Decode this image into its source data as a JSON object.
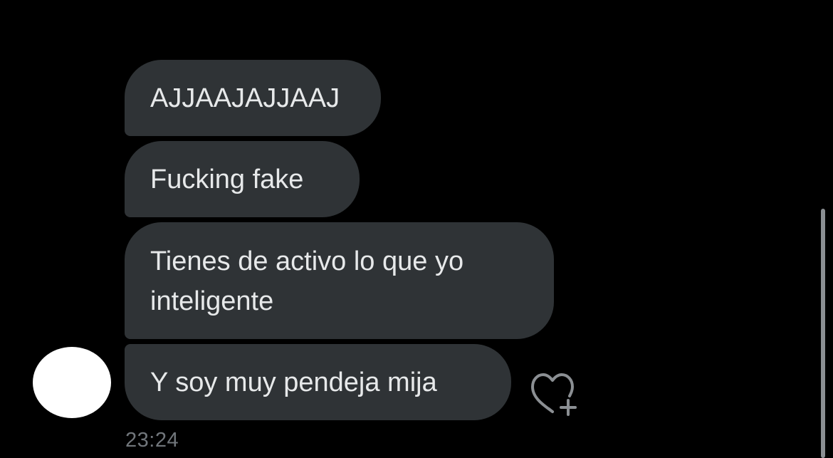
{
  "conversation": {
    "messages": [
      {
        "text": "AJJAAJAJJAAJ"
      },
      {
        "text": "Fucking fake"
      },
      {
        "text": "Tienes de activo lo que yo inteligente"
      },
      {
        "text": "Y soy muy pendeja mija"
      }
    ],
    "timestamp": "23:24"
  },
  "icons": {
    "react": "heart-plus-icon",
    "avatar": "avatar"
  },
  "colors": {
    "background": "#000000",
    "bubble": "#2f3336",
    "bubble_text": "#e7e9ea",
    "muted_text": "#71767b",
    "avatar": "#ffffff"
  }
}
